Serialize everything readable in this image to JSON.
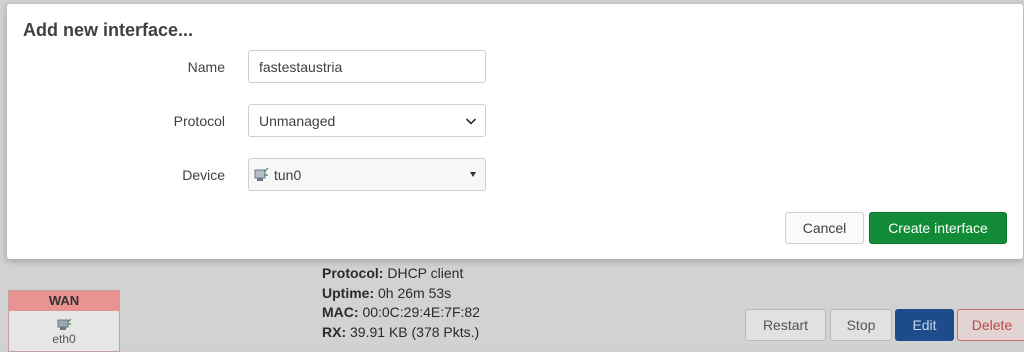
{
  "modal": {
    "title": "Add new interface...",
    "name_label": "Name",
    "name_value": "fastestaustria",
    "protocol_label": "Protocol",
    "protocol_value": "Unmanaged",
    "device_label": "Device",
    "device_value": "tun0",
    "cancel_label": "Cancel",
    "create_label": "Create interface"
  },
  "background": {
    "status": [
      {
        "key": "Protocol:",
        "value": "DHCP client"
      },
      {
        "key": "Uptime:",
        "value": "0h 26m 53s"
      },
      {
        "key": "MAC:",
        "value": "00:0C:29:4E:7F:82"
      },
      {
        "key": "RX:",
        "value": "39.91 KB (378 Pkts.)"
      }
    ],
    "wan_label": "WAN",
    "wan_device": "eth0",
    "buttons": {
      "restart": "Restart",
      "stop": "Stop",
      "edit": "Edit",
      "delete": "Delete"
    }
  },
  "colors": {
    "create_button": "#118b35",
    "edit_button": "#1d4b8c",
    "wan_header": "#e99292"
  },
  "icons": {
    "device": "network-adapter-icon",
    "select_arrow": "chevron-down-icon"
  }
}
